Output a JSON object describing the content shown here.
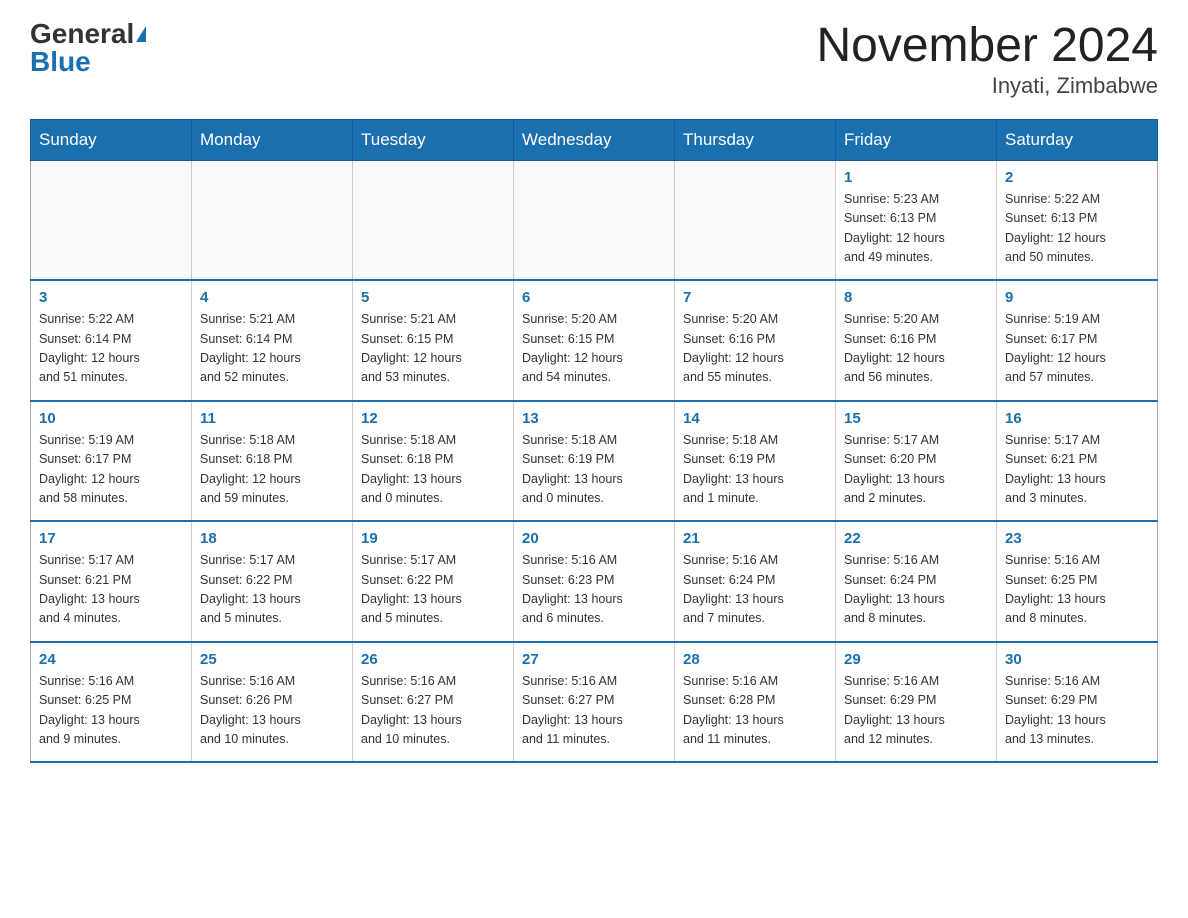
{
  "header": {
    "logo_general": "General",
    "logo_blue": "Blue",
    "title": "November 2024",
    "subtitle": "Inyati, Zimbabwe"
  },
  "days_of_week": [
    "Sunday",
    "Monday",
    "Tuesday",
    "Wednesday",
    "Thursday",
    "Friday",
    "Saturday"
  ],
  "weeks": [
    [
      {
        "day": "",
        "info": ""
      },
      {
        "day": "",
        "info": ""
      },
      {
        "day": "",
        "info": ""
      },
      {
        "day": "",
        "info": ""
      },
      {
        "day": "",
        "info": ""
      },
      {
        "day": "1",
        "info": "Sunrise: 5:23 AM\nSunset: 6:13 PM\nDaylight: 12 hours\nand 49 minutes."
      },
      {
        "day": "2",
        "info": "Sunrise: 5:22 AM\nSunset: 6:13 PM\nDaylight: 12 hours\nand 50 minutes."
      }
    ],
    [
      {
        "day": "3",
        "info": "Sunrise: 5:22 AM\nSunset: 6:14 PM\nDaylight: 12 hours\nand 51 minutes."
      },
      {
        "day": "4",
        "info": "Sunrise: 5:21 AM\nSunset: 6:14 PM\nDaylight: 12 hours\nand 52 minutes."
      },
      {
        "day": "5",
        "info": "Sunrise: 5:21 AM\nSunset: 6:15 PM\nDaylight: 12 hours\nand 53 minutes."
      },
      {
        "day": "6",
        "info": "Sunrise: 5:20 AM\nSunset: 6:15 PM\nDaylight: 12 hours\nand 54 minutes."
      },
      {
        "day": "7",
        "info": "Sunrise: 5:20 AM\nSunset: 6:16 PM\nDaylight: 12 hours\nand 55 minutes."
      },
      {
        "day": "8",
        "info": "Sunrise: 5:20 AM\nSunset: 6:16 PM\nDaylight: 12 hours\nand 56 minutes."
      },
      {
        "day": "9",
        "info": "Sunrise: 5:19 AM\nSunset: 6:17 PM\nDaylight: 12 hours\nand 57 minutes."
      }
    ],
    [
      {
        "day": "10",
        "info": "Sunrise: 5:19 AM\nSunset: 6:17 PM\nDaylight: 12 hours\nand 58 minutes."
      },
      {
        "day": "11",
        "info": "Sunrise: 5:18 AM\nSunset: 6:18 PM\nDaylight: 12 hours\nand 59 minutes."
      },
      {
        "day": "12",
        "info": "Sunrise: 5:18 AM\nSunset: 6:18 PM\nDaylight: 13 hours\nand 0 minutes."
      },
      {
        "day": "13",
        "info": "Sunrise: 5:18 AM\nSunset: 6:19 PM\nDaylight: 13 hours\nand 0 minutes."
      },
      {
        "day": "14",
        "info": "Sunrise: 5:18 AM\nSunset: 6:19 PM\nDaylight: 13 hours\nand 1 minute."
      },
      {
        "day": "15",
        "info": "Sunrise: 5:17 AM\nSunset: 6:20 PM\nDaylight: 13 hours\nand 2 minutes."
      },
      {
        "day": "16",
        "info": "Sunrise: 5:17 AM\nSunset: 6:21 PM\nDaylight: 13 hours\nand 3 minutes."
      }
    ],
    [
      {
        "day": "17",
        "info": "Sunrise: 5:17 AM\nSunset: 6:21 PM\nDaylight: 13 hours\nand 4 minutes."
      },
      {
        "day": "18",
        "info": "Sunrise: 5:17 AM\nSunset: 6:22 PM\nDaylight: 13 hours\nand 5 minutes."
      },
      {
        "day": "19",
        "info": "Sunrise: 5:17 AM\nSunset: 6:22 PM\nDaylight: 13 hours\nand 5 minutes."
      },
      {
        "day": "20",
        "info": "Sunrise: 5:16 AM\nSunset: 6:23 PM\nDaylight: 13 hours\nand 6 minutes."
      },
      {
        "day": "21",
        "info": "Sunrise: 5:16 AM\nSunset: 6:24 PM\nDaylight: 13 hours\nand 7 minutes."
      },
      {
        "day": "22",
        "info": "Sunrise: 5:16 AM\nSunset: 6:24 PM\nDaylight: 13 hours\nand 8 minutes."
      },
      {
        "day": "23",
        "info": "Sunrise: 5:16 AM\nSunset: 6:25 PM\nDaylight: 13 hours\nand 8 minutes."
      }
    ],
    [
      {
        "day": "24",
        "info": "Sunrise: 5:16 AM\nSunset: 6:25 PM\nDaylight: 13 hours\nand 9 minutes."
      },
      {
        "day": "25",
        "info": "Sunrise: 5:16 AM\nSunset: 6:26 PM\nDaylight: 13 hours\nand 10 minutes."
      },
      {
        "day": "26",
        "info": "Sunrise: 5:16 AM\nSunset: 6:27 PM\nDaylight: 13 hours\nand 10 minutes."
      },
      {
        "day": "27",
        "info": "Sunrise: 5:16 AM\nSunset: 6:27 PM\nDaylight: 13 hours\nand 11 minutes."
      },
      {
        "day": "28",
        "info": "Sunrise: 5:16 AM\nSunset: 6:28 PM\nDaylight: 13 hours\nand 11 minutes."
      },
      {
        "day": "29",
        "info": "Sunrise: 5:16 AM\nSunset: 6:29 PM\nDaylight: 13 hours\nand 12 minutes."
      },
      {
        "day": "30",
        "info": "Sunrise: 5:16 AM\nSunset: 6:29 PM\nDaylight: 13 hours\nand 13 minutes."
      }
    ]
  ]
}
